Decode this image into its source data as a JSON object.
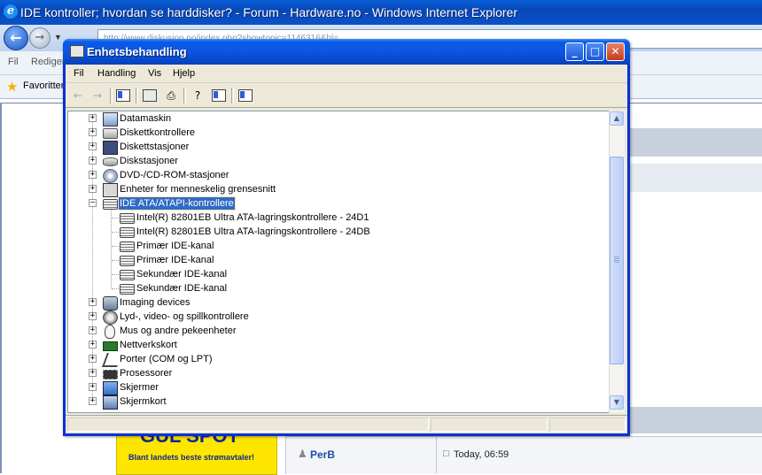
{
  "browser": {
    "title": "IDE kontroller; hvordan se harddisker? - Forum - Hardware.no - Windows Internet Explorer",
    "address": "http://www.diskusjon.no/index.php?showtopic=1146316&hl=",
    "menu": [
      "Fil",
      "Rediger"
    ],
    "favorites_label": "Favoritter"
  },
  "forum": {
    "ad_title": "GUL SPOT",
    "ad_subtitle": "Blant landets beste strømavtaler!",
    "post_user": "PerB",
    "post_time": "Today, 06:59"
  },
  "device_manager": {
    "title": "Enhetsbehandling",
    "menu": [
      "Fil",
      "Handling",
      "Vis",
      "Hjelp"
    ],
    "toolbar": [
      "back-icon",
      "forward-icon",
      "show-hide-tree-icon",
      "properties-icon",
      "print-icon",
      "help-icon",
      "toggle-view-icon",
      "scan-hardware-icon"
    ],
    "tree": [
      {
        "label": "Datamaskin",
        "icon": "computer-icon",
        "expanded": false
      },
      {
        "label": "Diskettkontrollere",
        "icon": "floppy-controller-icon",
        "expanded": false
      },
      {
        "label": "Diskettstasjoner",
        "icon": "floppy-drive-icon",
        "expanded": false
      },
      {
        "label": "Diskstasjoner",
        "icon": "disk-drive-icon",
        "expanded": false
      },
      {
        "label": "DVD-/CD-ROM-stasjoner",
        "icon": "cdrom-icon",
        "expanded": false
      },
      {
        "label": "Enheter for menneskelig grensesnitt",
        "icon": "hid-icon",
        "expanded": false
      },
      {
        "label": "IDE ATA/ATAPI-kontrollere",
        "icon": "ide-controller-icon",
        "expanded": true,
        "selected": true,
        "children": [
          "Intel(R) 82801EB Ultra ATA-lagringskontrollere - 24D1",
          "Intel(R) 82801EB Ultra ATA-lagringskontrollere - 24DB",
          "Primær IDE-kanal",
          "Primær IDE-kanal",
          "Sekundær IDE-kanal",
          "Sekundær IDE-kanal"
        ]
      },
      {
        "label": "Imaging devices",
        "icon": "imaging-icon",
        "expanded": false
      },
      {
        "label": "Lyd-, video- og spillkontrollere",
        "icon": "sound-icon",
        "expanded": false
      },
      {
        "label": "Mus og andre pekeenheter",
        "icon": "mouse-icon",
        "expanded": false
      },
      {
        "label": "Nettverkskort",
        "icon": "network-icon",
        "expanded": false
      },
      {
        "label": "Porter (COM og LPT)",
        "icon": "port-icon",
        "expanded": false
      },
      {
        "label": "Prosessorer",
        "icon": "processor-icon",
        "expanded": false
      },
      {
        "label": "Skjermer",
        "icon": "monitor-icon",
        "expanded": false
      },
      {
        "label": "Skjermkort",
        "icon": "display-adapter-icon",
        "expanded": false
      }
    ]
  }
}
